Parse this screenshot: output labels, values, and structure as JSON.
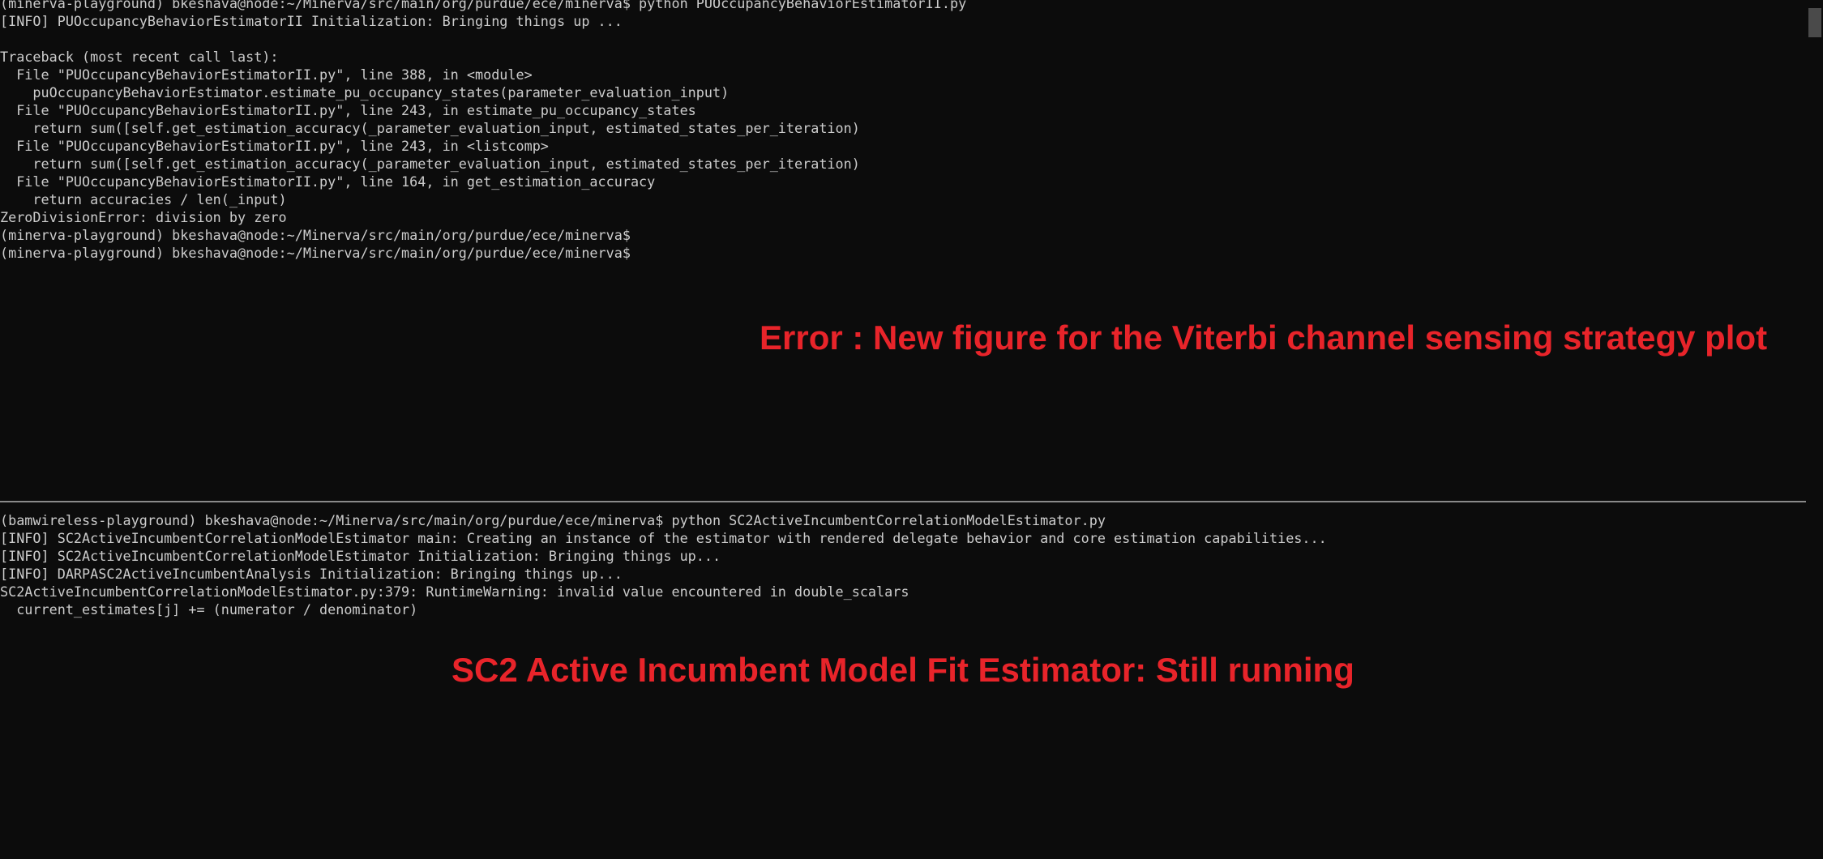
{
  "top_terminal": {
    "lines": [
      "(minerva-playground) bkeshava@node:~/Minerva/src/main/org/purdue/ece/minerva$ python PUOccupancyBehaviorEstimatorII.py",
      "[INFO] PUOccupancyBehaviorEstimatorII Initialization: Bringing things up ...",
      "",
      "Traceback (most recent call last):",
      "  File \"PUOccupancyBehaviorEstimatorII.py\", line 388, in <module>",
      "    puOccupancyBehaviorEstimator.estimate_pu_occupancy_states(parameter_evaluation_input)",
      "  File \"PUOccupancyBehaviorEstimatorII.py\", line 243, in estimate_pu_occupancy_states",
      "    return sum([self.get_estimation_accuracy(_parameter_evaluation_input, estimated_states_per_iteration)",
      "  File \"PUOccupancyBehaviorEstimatorII.py\", line 243, in <listcomp>",
      "    return sum([self.get_estimation_accuracy(_parameter_evaluation_input, estimated_states_per_iteration)",
      "  File \"PUOccupancyBehaviorEstimatorII.py\", line 164, in get_estimation_accuracy",
      "    return accuracies / len(_input)",
      "ZeroDivisionError: division by zero",
      "(minerva-playground) bkeshava@node:~/Minerva/src/main/org/purdue/ece/minerva$",
      "(minerva-playground) bkeshava@node:~/Minerva/src/main/org/purdue/ece/minerva$"
    ],
    "annotation": "Error : New figure for the Viterbi channel sensing strategy plot"
  },
  "bottom_terminal": {
    "lines": [
      "(bamwireless-playground) bkeshava@node:~/Minerva/src/main/org/purdue/ece/minerva$ python SC2ActiveIncumbentCorrelationModelEstimator.py",
      "[INFO] SC2ActiveIncumbentCorrelationModelEstimator main: Creating an instance of the estimator with rendered delegate behavior and core estimation capabilities...",
      "[INFO] SC2ActiveIncumbentCorrelationModelEstimator Initialization: Bringing things up...",
      "[INFO] DARPASC2ActiveIncumbentAnalysis Initialization: Bringing things up...",
      "SC2ActiveIncumbentCorrelationModelEstimator.py:379: RuntimeWarning: invalid value encountered in double_scalars",
      "  current_estimates[j] += (numerator / denominator)"
    ],
    "annotation": "SC2 Active Incumbent Model Fit Estimator: Still running"
  },
  "colors": {
    "background": "#0c0c0c",
    "text": "#cccccc",
    "annotation": "#e8242a",
    "divider": "#8a8a8a"
  }
}
